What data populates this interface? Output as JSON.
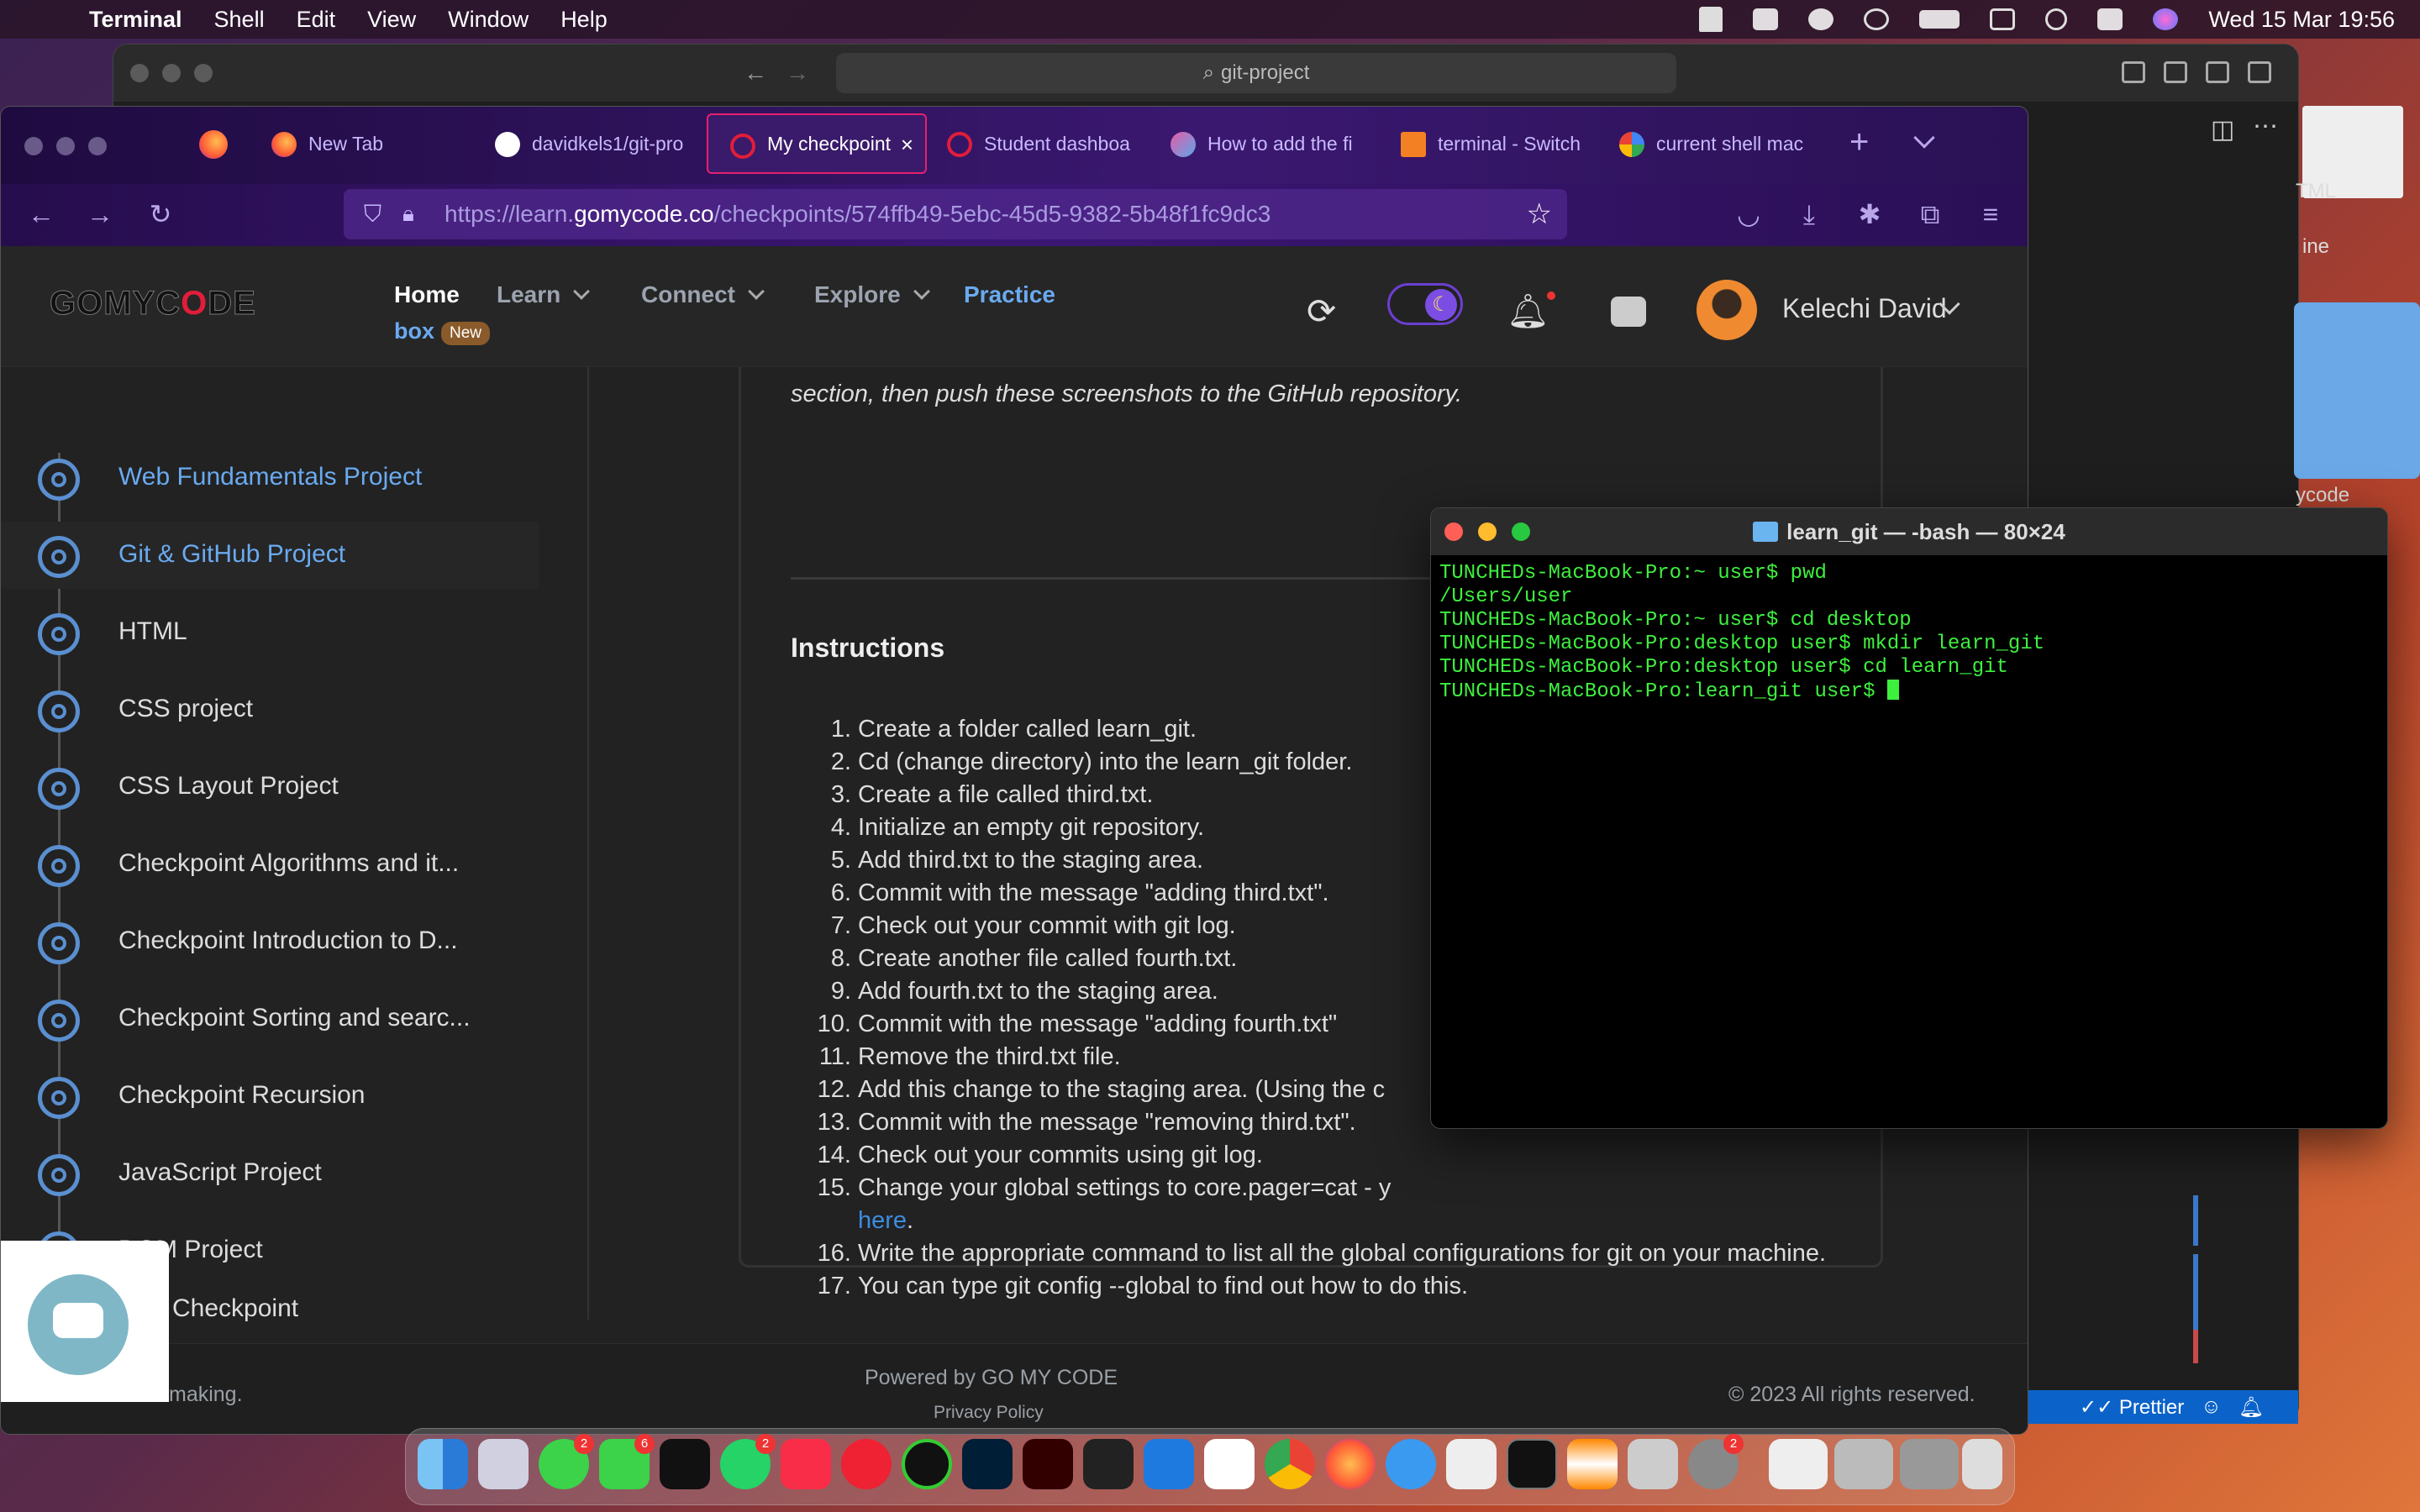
{
  "menubar": {
    "app": "Terminal",
    "items": [
      "Shell",
      "Edit",
      "View",
      "Window",
      "Help"
    ],
    "datetime": "Wed 15 Mar  19:56"
  },
  "back_window": {
    "search": "git-project",
    "status_items": [
      "Prettier"
    ],
    "peek_labels": [
      "TML",
      "ine",
      "ycode"
    ]
  },
  "browser": {
    "tabs": [
      {
        "label": "New Tab"
      },
      {
        "label": "davidkels1/git-pro"
      },
      {
        "label": "My checkpoint"
      },
      {
        "label": "Student dashboa"
      },
      {
        "label": "How to add the fi"
      },
      {
        "label": "terminal - Switch"
      },
      {
        "label": "current shell mac"
      }
    ],
    "url_prefix": "https://learn.",
    "url_host": "gomycode.co",
    "url_path": "/checkpoints/574ffb49-5ebc-45d5-9382-5b48f1fc9dc3"
  },
  "site": {
    "logo_a": "GOMYC",
    "logo_o": "O",
    "logo_b": "DE",
    "nav": {
      "home": "Home",
      "learn": "Learn",
      "connect": "Connect",
      "explore": "Explore",
      "practice": "Practice",
      "box": "box",
      "new_badge": "New"
    },
    "user_name": "Kelechi David",
    "sidebar": [
      {
        "label": "Web Fundamentals Project"
      },
      {
        "label": "Git & GitHub Project"
      },
      {
        "label": "HTML"
      },
      {
        "label": "CSS project"
      },
      {
        "label": "CSS Layout Project"
      },
      {
        "label": "Checkpoint Algorithms and it..."
      },
      {
        "label": "Checkpoint Introduction to D..."
      },
      {
        "label": "Checkpoint Sorting and searc..."
      },
      {
        "label": "Checkpoint Recursion"
      },
      {
        "label": "JavaScript Project"
      },
      {
        "label": "DOM Project"
      },
      {
        "label": "Checkpoint"
      }
    ],
    "intro": "section, then push these screenshots to the GitHub repository.",
    "instructions_title": "Instructions",
    "instructions": [
      {
        "n": "1.",
        "t": "Create a folder called learn_git."
      },
      {
        "n": "2.",
        "t": "Cd (change directory) into the learn_git folder."
      },
      {
        "n": "3.",
        "t": "Create a file called third.txt."
      },
      {
        "n": "4.",
        "t": "Initialize an empty git repository."
      },
      {
        "n": "5.",
        "t": "Add third.txt to the staging area."
      },
      {
        "n": "6.",
        "t": "Commit with the message \"adding third.txt\"."
      },
      {
        "n": "7.",
        "t": "Check out your commit with git log."
      },
      {
        "n": "8.",
        "t": "Create another file called fourth.txt."
      },
      {
        "n": "9.",
        "t": "Add fourth.txt to the staging area."
      },
      {
        "n": "10.",
        "t": "Commit with the message \"adding fourth.txt\""
      },
      {
        "n": "11.",
        "t": "Remove the third.txt file."
      },
      {
        "n": "12.",
        "t": "Add this change to the staging area. (Using the c"
      },
      {
        "n": "13.",
        "t": "Commit with the message \"removing third.txt\"."
      },
      {
        "n": "14.",
        "t": "Check out your commits using git log."
      },
      {
        "n": "15.",
        "t": "Change your global settings to core.pager=cat - y"
      },
      {
        "n": "16.",
        "t": "Write the appropriate command to list all the global configurations for git on your machine."
      },
      {
        "n": "17.",
        "t": "You can type git config --global to find out how to do this."
      }
    ],
    "here_link": "here",
    "footer": {
      "powered": "Powered by GO MY CODE",
      "privacy": "Privacy Policy",
      "making": "making.",
      "copyright": "© 2023 All rights reserved."
    }
  },
  "terminal": {
    "title": "learn_git — -bash — 80×24",
    "lines": [
      "TUNCHEDs-MacBook-Pro:~ user$ pwd",
      "/Users/user",
      "TUNCHEDs-MacBook-Pro:~ user$ cd desktop",
      "TUNCHEDs-MacBook-Pro:desktop user$ mkdir learn_git",
      "TUNCHEDs-MacBook-Pro:desktop user$ cd learn_git",
      "TUNCHEDs-MacBook-Pro:learn_git user$ "
    ]
  },
  "dock": {
    "badges": [
      "2",
      "6",
      "2",
      "2"
    ]
  }
}
